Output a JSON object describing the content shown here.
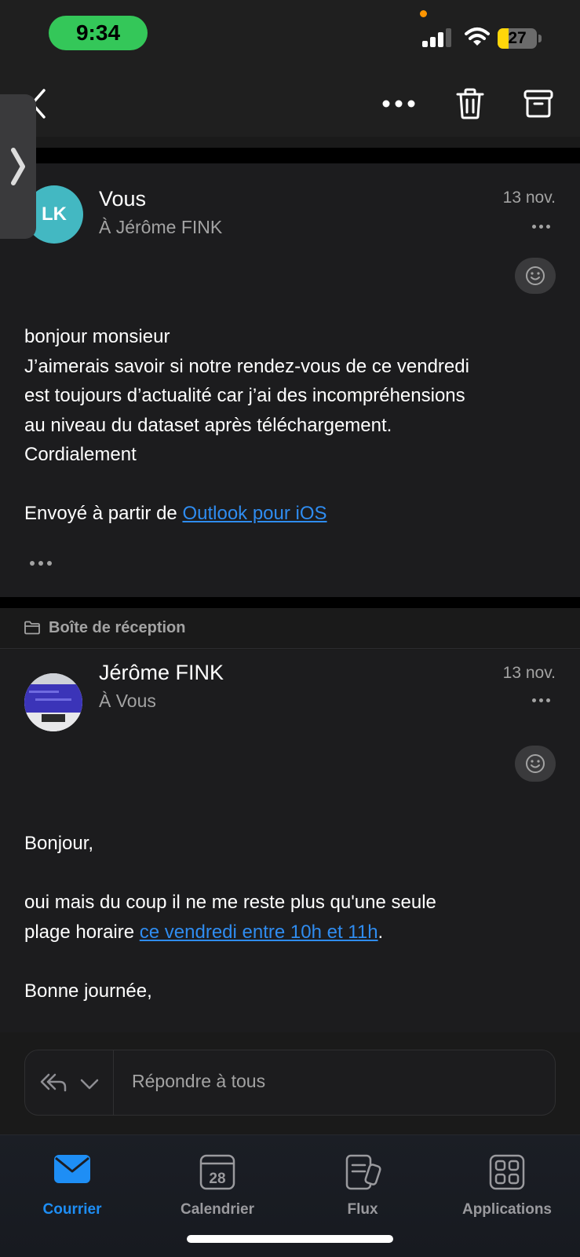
{
  "status_bar": {
    "time": "9:34",
    "battery_level": "27",
    "battery_fraction": 0.27,
    "colors": {
      "time_pill": "#34c759",
      "battery_fill": "#ffd60a",
      "privacy_dot": "#ff9500"
    }
  },
  "toolbar": {
    "back_icon": "chevron-left-icon",
    "more_icon": "ellipsis-icon",
    "delete_icon": "trash-icon",
    "archive_icon": "archive-box-icon"
  },
  "message1": {
    "avatar_initials": "LK",
    "sender": "Vous",
    "recipient": "À Jérôme FINK",
    "date": "13 nov.",
    "body_lines": [
      "bonjour monsieur",
      "J’aimerais savoir si notre rendez-vous de ce vendredi",
      "est toujours d’actualité car j’ai des incompréhensions",
      "au niveau du dataset après téléchargement.",
      "Cordialement"
    ],
    "signature_prefix": "Envoyé à partir de ",
    "signature_link": "Outlook pour iOS"
  },
  "folder": {
    "icon": "folder-icon",
    "label": "Boîte de réception"
  },
  "message2": {
    "sender": "Jérôme FINK",
    "recipient": "À Vous",
    "date": "13 nov.",
    "greeting": "Bonjour,",
    "line1": "oui mais du coup il ne me reste plus qu'une seule",
    "line2_prefix": "plage horaire ",
    "line2_link": "ce vendredi entre 10h et 11h",
    "line2_suffix": ".",
    "closing": "Bonne journée,"
  },
  "reply": {
    "placeholder": "Répondre à tous"
  },
  "tabs": [
    {
      "label": "Courrier",
      "icon": "mail-icon",
      "active": true
    },
    {
      "label": "Calendrier",
      "icon": "calendar-icon",
      "day": "28",
      "active": false
    },
    {
      "label": "Flux",
      "icon": "feed-icon",
      "active": false
    },
    {
      "label": "Applications",
      "icon": "apps-grid-icon",
      "active": false
    }
  ],
  "colors": {
    "accent": "#1e8ef5",
    "link": "#2f8cf0",
    "avatar_lk": "#43b8c2"
  }
}
